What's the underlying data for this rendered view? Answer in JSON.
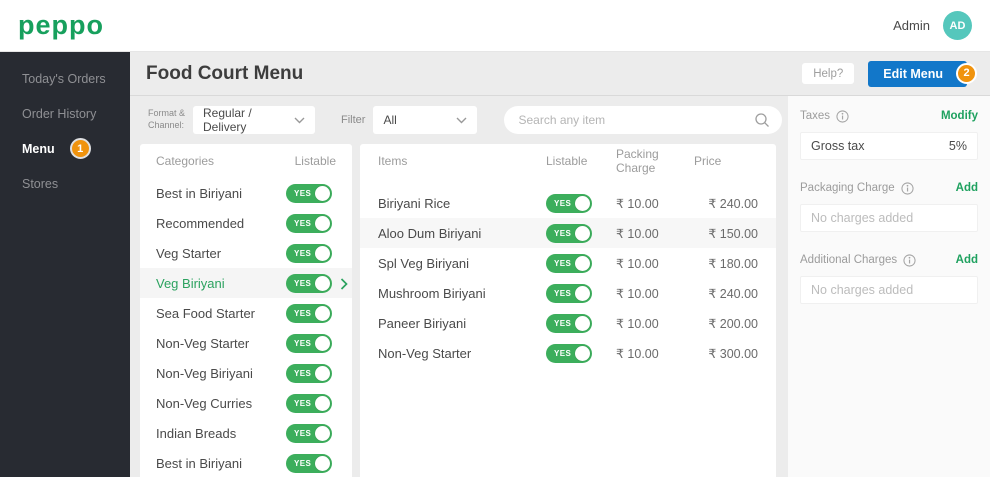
{
  "header": {
    "logo": "peppo",
    "user_name": "Admin",
    "avatar_initials": "AD"
  },
  "sidebar": {
    "items": [
      {
        "label": "Today's Orders"
      },
      {
        "label": "Order History"
      },
      {
        "label": "Menu",
        "badge": "1"
      },
      {
        "label": "Stores"
      }
    ]
  },
  "titlebar": {
    "title": "Food Court Menu",
    "help_label": "Help?",
    "edit_menu_label": "Edit Menu",
    "edit_menu_badge": "2"
  },
  "filters": {
    "format_label_line1": "Format &",
    "format_label_line2": "Channel:",
    "format_value": "Regular / Delivery",
    "filter_label": "Filter",
    "filter_value": "All",
    "search_placeholder": "Search any item"
  },
  "labels": {
    "yes": "YES"
  },
  "categories": {
    "col_name": "Categories",
    "col_listable": "Listable",
    "rows": [
      {
        "name": "Best in Biriyani",
        "listable": "YES"
      },
      {
        "name": "Recommended",
        "listable": "YES"
      },
      {
        "name": "Veg Starter",
        "listable": "YES"
      },
      {
        "name": "Veg Biriyani",
        "listable": "YES",
        "selected": true
      },
      {
        "name": "Sea Food Starter",
        "listable": "YES"
      },
      {
        "name": "Non-Veg Starter",
        "listable": "YES"
      },
      {
        "name": "Non-Veg Biriyani",
        "listable": "YES"
      },
      {
        "name": "Non-Veg  Curries",
        "listable": "YES"
      },
      {
        "name": "Indian Breads",
        "listable": "YES"
      },
      {
        "name": "Best in Biriyani",
        "listable": "YES"
      }
    ]
  },
  "items": {
    "col_items": "Items",
    "col_listable": "Listable",
    "col_packing": "Packing Charge",
    "col_price": "Price",
    "rows": [
      {
        "name": "Biriyani Rice",
        "listable": "YES",
        "packing_charge": "₹ 10.00",
        "price": "₹ 240.00"
      },
      {
        "name": "Aloo Dum Biriyani",
        "listable": "YES",
        "packing_charge": "₹ 10.00",
        "price": "₹ 150.00"
      },
      {
        "name": "Spl Veg Biriyani",
        "listable": "YES",
        "packing_charge": "₹ 10.00",
        "price": "₹ 180.00"
      },
      {
        "name": "Mushroom Biriyani",
        "listable": "YES",
        "packing_charge": "₹ 10.00",
        "price": "₹ 240.00"
      },
      {
        "name": "Paneer Biriyani",
        "listable": "YES",
        "packing_charge": "₹ 10.00",
        "price": "₹ 200.00"
      },
      {
        "name": "Non-Veg Starter",
        "listable": "YES",
        "packing_charge": "₹ 10.00",
        "price": "₹ 300.00"
      }
    ]
  },
  "charges": {
    "taxes_label": "Taxes",
    "taxes_action": "Modify",
    "tax_name": "Gross tax",
    "tax_value": "5%",
    "packaging_label": "Packaging Charge",
    "packaging_action": "Add",
    "packaging_empty": "No charges added",
    "additional_label": "Additional Charges",
    "additional_action": "Add",
    "additional_empty": "No charges added"
  },
  "colors": {
    "brand_green": "#17A05D",
    "accent_green": "#1EA15F",
    "toggle_green": "#3CAE5C",
    "primary_blue": "#1277C9",
    "badge_orange": "#F0930E",
    "sidebar_dark": "#282B32",
    "avatar_teal": "#55C7BC"
  }
}
